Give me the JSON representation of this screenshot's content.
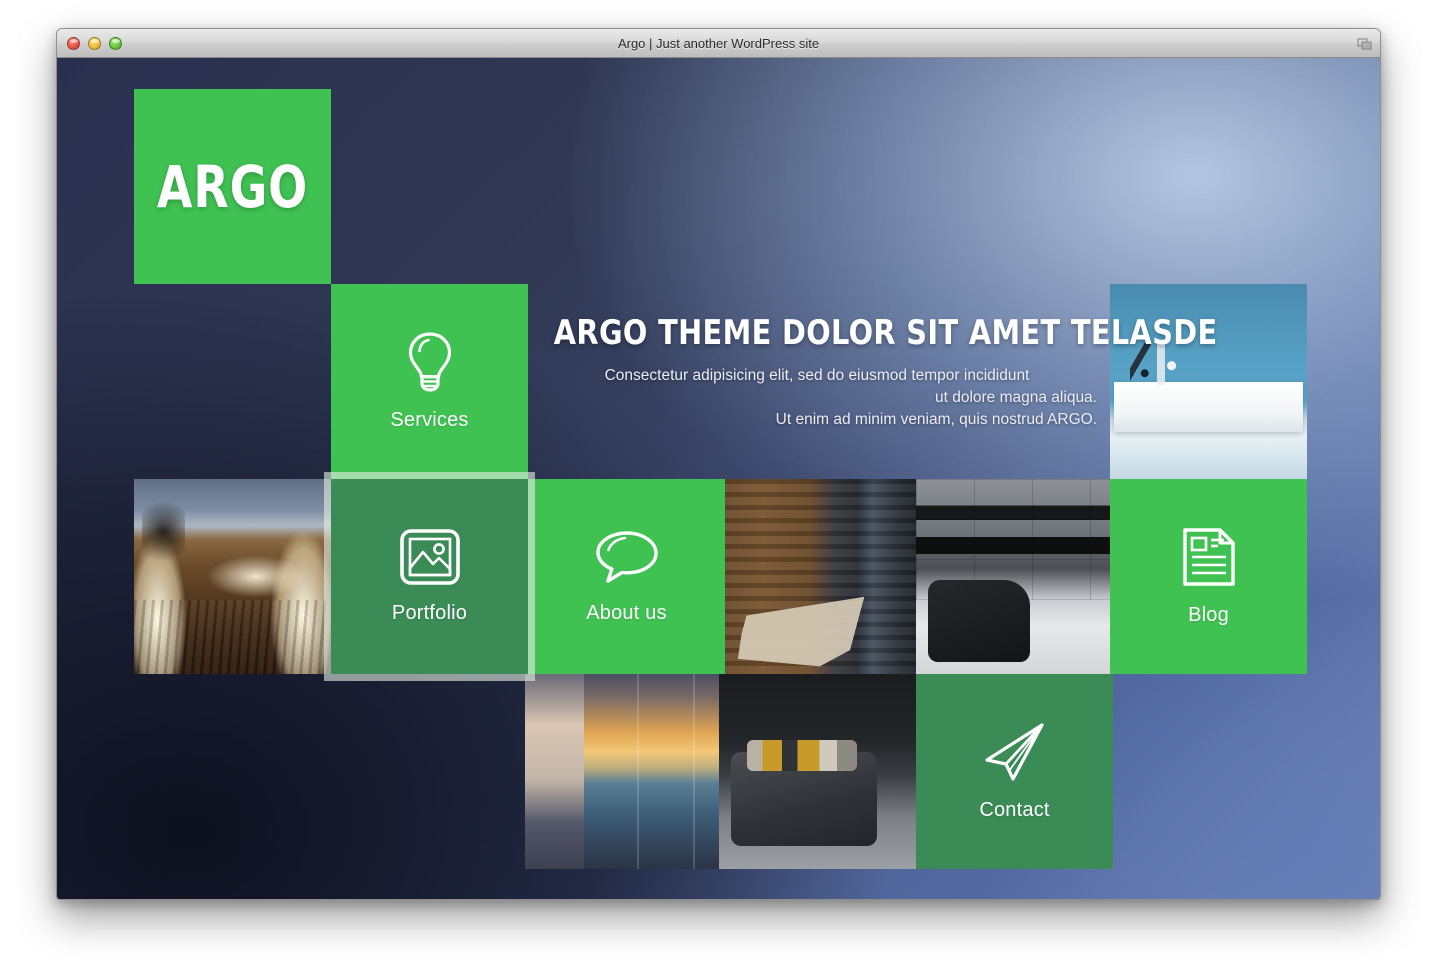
{
  "window": {
    "title": "Argo | Just another WordPress site",
    "controls": [
      {
        "name": "close",
        "label": "Close"
      },
      {
        "name": "minimize",
        "label": "Minimize"
      },
      {
        "name": "zoom",
        "label": "Zoom"
      }
    ],
    "resize_icon": "resize-handle-icon"
  },
  "site": {
    "logo": "ARGO",
    "hero": {
      "title": "ARGO THEME DOLOR SIT AMET TELASDE",
      "line1": "Consectetur adipisicing elit, sed do eiusmod tempor incididunt",
      "line2": "ut dolore magna aliqua.",
      "line3": "Ut enim ad minim veniam, quis nostrud ARGO."
    },
    "tiles": [
      {
        "id": "services",
        "label": "Services",
        "icon": "lightbulb-icon",
        "state": "default"
      },
      {
        "id": "portfolio",
        "label": "Portfolio",
        "icon": "image-icon",
        "state": "hover"
      },
      {
        "id": "about",
        "label": "About us",
        "icon": "speech-bubble-icon",
        "state": "default"
      },
      {
        "id": "blog",
        "label": "Blog",
        "icon": "article-icon",
        "state": "default"
      },
      {
        "id": "contact",
        "label": "Contact",
        "icon": "paper-plane-icon",
        "state": "hover"
      }
    ],
    "photos": [
      {
        "id": "terrace",
        "alt": "Illuminated rooftop terrace at dusk"
      },
      {
        "id": "wood",
        "alt": "Wooden dining room with concrete table"
      },
      {
        "id": "darkroom",
        "alt": "Dark modern living room with black sofa"
      },
      {
        "id": "sunset",
        "alt": "Glass-walled room overlooking sunset water"
      },
      {
        "id": "sofa",
        "alt": "Grey sofa with ochre cushions and floor lamp"
      },
      {
        "id": "sideboard",
        "alt": "White sideboard against blue wall"
      }
    ]
  },
  "colors": {
    "green": "#40c253",
    "green_hover": "#3a8b56",
    "focus_ring": "#e1ebe1",
    "text_light": "#ffffff",
    "bg_dark": "#2a3150",
    "bg_light": "#8fa4cc"
  }
}
